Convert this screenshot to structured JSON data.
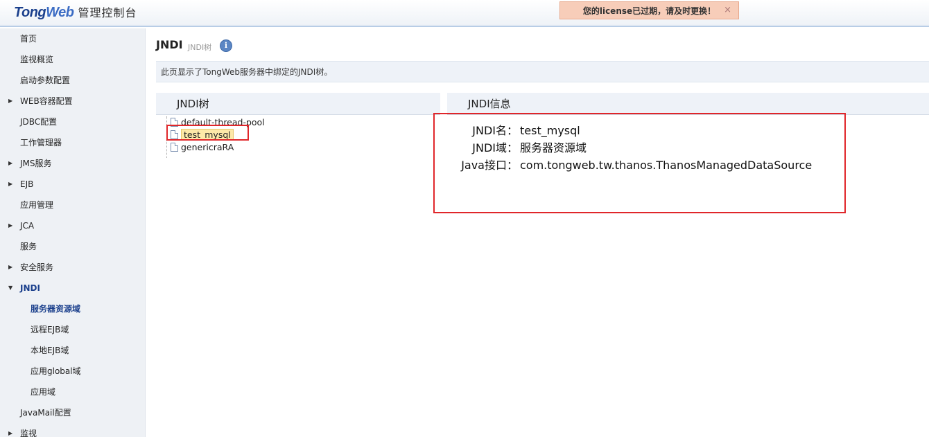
{
  "header": {
    "logo_tong": "Tong",
    "logo_web": "Web",
    "logo_cn": "管理控制台",
    "license_message": "您的license已过期，请及时更换！",
    "license_close": "×"
  },
  "sidebar": {
    "items": [
      {
        "label": "首页",
        "arrow": ""
      },
      {
        "label": "监视概览",
        "arrow": ""
      },
      {
        "label": "启动参数配置",
        "arrow": ""
      },
      {
        "label": "WEB容器配置",
        "arrow": "▶"
      },
      {
        "label": "JDBC配置",
        "arrow": ""
      },
      {
        "label": "工作管理器",
        "arrow": ""
      },
      {
        "label": "JMS服务",
        "arrow": "▶"
      },
      {
        "label": "EJB",
        "arrow": "▶"
      },
      {
        "label": "应用管理",
        "arrow": ""
      },
      {
        "label": "JCA",
        "arrow": "▶"
      },
      {
        "label": "服务",
        "arrow": ""
      },
      {
        "label": "安全服务",
        "arrow": "▶"
      },
      {
        "label": "JNDI",
        "arrow": "▼"
      },
      {
        "label": "服务器资源域",
        "arrow": ""
      },
      {
        "label": "远程EJB域",
        "arrow": ""
      },
      {
        "label": "本地EJB域",
        "arrow": ""
      },
      {
        "label": "应用global域",
        "arrow": ""
      },
      {
        "label": "应用域",
        "arrow": ""
      },
      {
        "label": "JavaMail配置",
        "arrow": ""
      },
      {
        "label": "监视",
        "arrow": "▶"
      }
    ]
  },
  "main": {
    "title": "JNDI",
    "subtitle": "JNDI树",
    "info_icon": "i",
    "description": "此页显示了TongWeb服务器中绑定的JNDI树。",
    "tree_header": "JNDI树",
    "info_header": "JNDI信息",
    "tree": [
      "default-thread-pool",
      "test_mysql",
      "genericraRA"
    ],
    "info": [
      {
        "key": "JNDI名：",
        "value": "test_mysql"
      },
      {
        "key": "JNDI域：",
        "value": "服务器资源域"
      },
      {
        "key": "Java接口：",
        "value": "com.tongweb.tw.thanos.ThanosManagedDataSource"
      }
    ]
  }
}
